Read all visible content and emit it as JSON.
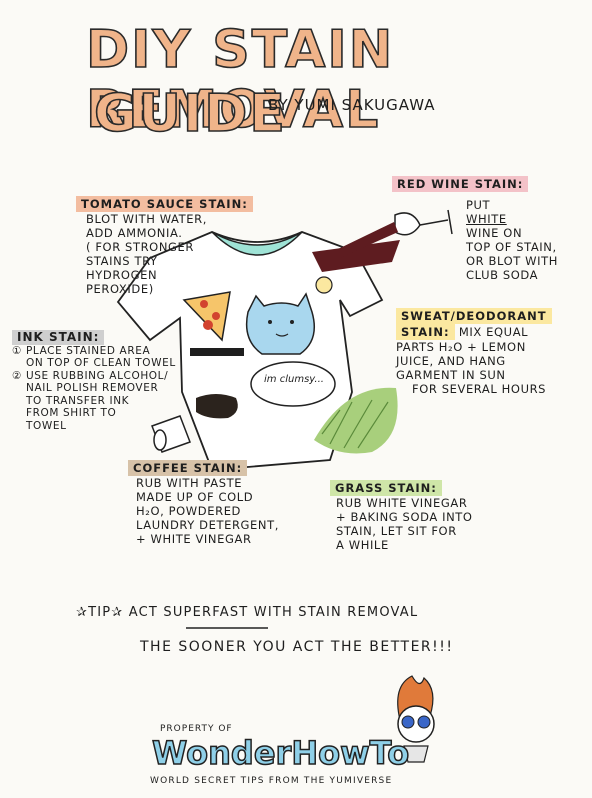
{
  "title": {
    "line1": "DIY STAIN REMOVAL",
    "line2": "GUIDE",
    "byline": "BY YUMI SAKUGAWA"
  },
  "tomato": {
    "heading": "TOMATO SAUCE STAIN:",
    "text1": "BLOT WITH WATER,",
    "text2": "ADD AMMONIA.",
    "note1": "( FOR STRONGER",
    "note2": "STAINS TRY",
    "note3": "HYDROGEN",
    "note4": "PEROXIDE)"
  },
  "redwine": {
    "heading": "RED WINE STAIN:",
    "text1": "PUT",
    "text2": "WHITE",
    "text3": "WINE ON",
    "text4": "TOP OF STAIN,",
    "text5": "OR BLOT WITH",
    "text6": "CLUB SODA"
  },
  "sweat": {
    "heading1": "SWEAT/DEODORANT",
    "heading2": "STAIN:",
    "text1": "MIX EQUAL",
    "text2": "PARTS H₂O + LEMON",
    "text3": "JUICE, AND HANG",
    "text4": "GARMENT IN SUN",
    "text5": "FOR SEVERAL HOURS"
  },
  "ink": {
    "heading": "INK STAIN:",
    "step1a": "① PLACE STAINED AREA",
    "step1b": "ON TOP OF CLEAN TOWEL",
    "step2a": "② USE RUBBING ALCOHOL/",
    "step2b": "NAIL POLISH REMOVER",
    "step2c": "TO TRANSFER INK",
    "step2d": "FROM SHIRT TO",
    "step2e": "TOWEL"
  },
  "coffee": {
    "heading": "COFFEE STAIN:",
    "text1": "RUB WITH PASTE",
    "text2": "MADE UP OF COLD",
    "text3": "H₂O, POWDERED",
    "text4": "LAUNDRY DETERGENT,",
    "text5": "+ WHITE VINEGAR"
  },
  "grass": {
    "heading": "GRASS STAIN:",
    "text1": "RUB WHITE VINEGAR",
    "text2": "+ BAKING SODA INTO",
    "text3": "STAIN, LET SIT FOR",
    "text4": "A WHILE"
  },
  "shirt_bubble": "im clumsy...",
  "tip": {
    "label": "✰TIP✰",
    "text_a": "ACT",
    "text_b": "SUPERFAST",
    "text_c": "WITH STAIN REMOVAL",
    "line2": "THE SOONER YOU ACT THE BETTER!!!"
  },
  "footer": {
    "property": "PROPERTY OF",
    "brand": "WonderHowTo",
    "tagline": "WORLD SECRET TIPS FROM THE YUMIVERSE"
  },
  "colors": {
    "title_fill": "#f0b48a",
    "tomato_hl": "#f3bda0",
    "redwine_hl": "#f3c2c8",
    "sweat_hl": "#fbe8a0",
    "ink_hl": "#cfcfcf",
    "coffee_hl": "#d7c2a8",
    "grass_hl": "#cfe6a8",
    "collar": "#9fe3d6",
    "cat": "#a9d7ee",
    "grass": "#a8cf7c",
    "wine": "#5e1c20"
  },
  "icons": [
    "pizza-slice-icon",
    "wine-glass-icon",
    "coffee-cup-icon",
    "pen-icon",
    "cat-illustration",
    "mascot-icon"
  ]
}
